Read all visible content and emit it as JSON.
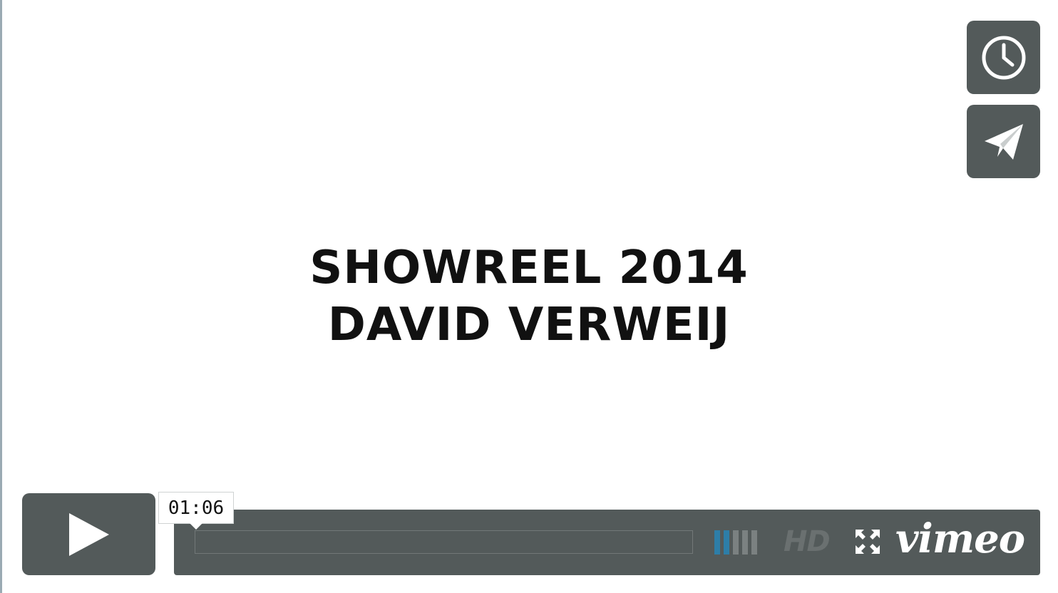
{
  "video": {
    "title_line1": "SHOWREEL 2014",
    "title_line2": "DAVID VERWEIJ"
  },
  "side_buttons": {
    "later_icon": "clock-icon",
    "share_icon": "paper-plane-icon"
  },
  "controls": {
    "play_icon": "play-icon",
    "time_tooltip": "01:06",
    "progress_fraction": 0,
    "volume_level": 2,
    "volume_bars": 5,
    "hd_label": "HD",
    "fullscreen_icon": "fullscreen-icon",
    "logo_text": "vimeo"
  },
  "colors": {
    "control_bg": "#535a5a",
    "volume_active": "#2d7ea8",
    "volume_inactive": "#7b8181",
    "hd_inactive": "#6a7070"
  }
}
